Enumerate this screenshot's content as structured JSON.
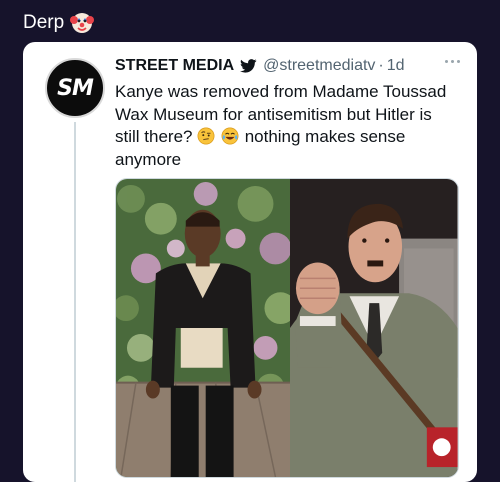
{
  "post": {
    "title": "Derp",
    "title_emoji": "clown-face"
  },
  "tweet": {
    "display_name": "STREET MEDIA",
    "handle": "@streetmediatv",
    "separator": "·",
    "time": "1d",
    "avatar_text": "SM",
    "text_part1": "Kanye was removed from Madame Toussad Wax Museum for antisemitism but Hitler is still there?",
    "text_part2": "nothing makes sense anymore",
    "emojis": [
      "face-with-raised-eyebrow",
      "face-with-tears-of-joy"
    ],
    "media": {
      "left_image": "wax figure of man in black blazer against floral wall",
      "right_image": "wax figure of man in military uniform with raised fist"
    }
  },
  "colors": {
    "background": "#16132b",
    "card": "#ffffff",
    "text_primary": "#0f1419",
    "text_secondary": "#536471",
    "twitter_blue": "#1d9bf0"
  }
}
